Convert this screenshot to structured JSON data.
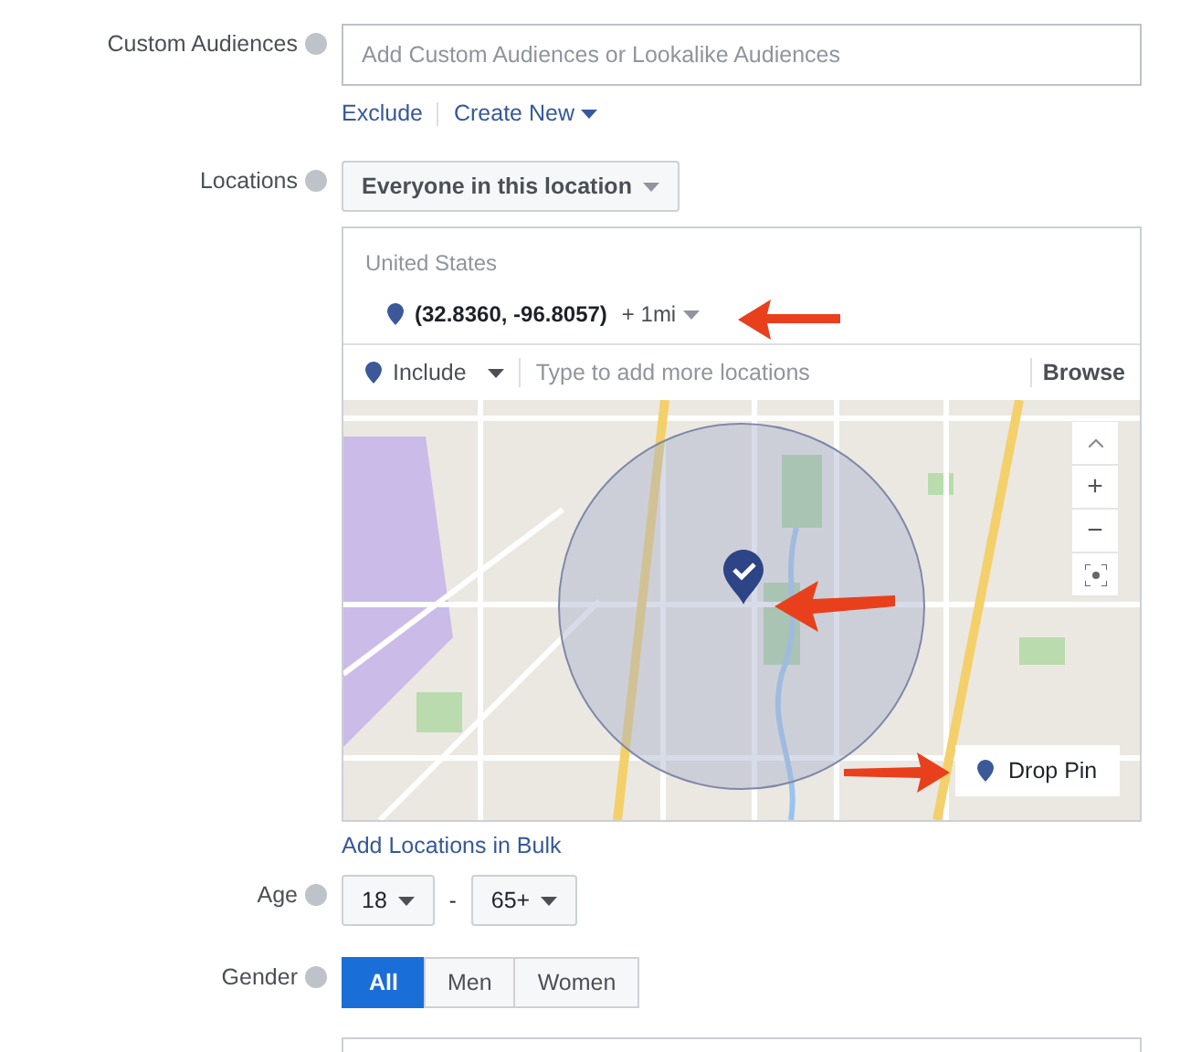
{
  "custom_audiences": {
    "label": "Custom Audiences",
    "placeholder": "Add Custom Audiences or Lookalike Audiences",
    "links": [
      "Exclude",
      "Create New"
    ]
  },
  "locations": {
    "label": "Locations",
    "audience_dropdown": "Everyone in this location",
    "country": "United States",
    "pin": {
      "coordinates": "(32.8360, -96.8057)",
      "radius": "+ 1mi"
    },
    "include_dropdown": "Include",
    "placeholder": "Type to add more locations",
    "browse": "Browse",
    "map": {
      "zoom_controls": [
        "+",
        "−"
      ],
      "drop_pin": "Drop Pin"
    },
    "bulk_link": "Add Locations in Bulk"
  },
  "age": {
    "label": "Age",
    "min": "18",
    "separator": "-",
    "max": "65+"
  },
  "gender": {
    "label": "Gender",
    "options": [
      {
        "label": "All",
        "selected": true
      },
      {
        "label": "Men",
        "selected": false
      },
      {
        "label": "Women",
        "selected": false
      }
    ]
  }
}
